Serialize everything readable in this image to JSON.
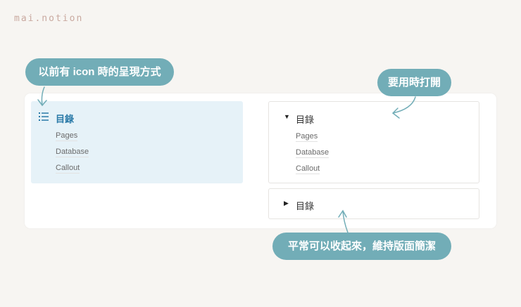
{
  "logo": "mai.notion",
  "left_toc": {
    "title": "目錄",
    "icon": "list-icon",
    "items": [
      "Pages",
      "Database",
      "Callout"
    ]
  },
  "toggle_open": {
    "title": "目錄",
    "icon": "triangle-down-icon",
    "items": [
      "Pages",
      "Database",
      "Callout"
    ]
  },
  "toggle_closed": {
    "title": "目錄",
    "icon": "triangle-right-icon"
  },
  "bubbles": {
    "old": "以前有 icon 時的呈現方式",
    "open": "要用時打開",
    "closed": "平常可以收起來，維持版面簡潔"
  },
  "colors": {
    "accent": "#72adb7",
    "toc_blue": "#2a7aa8",
    "toc_bg": "#e6f2f8"
  }
}
